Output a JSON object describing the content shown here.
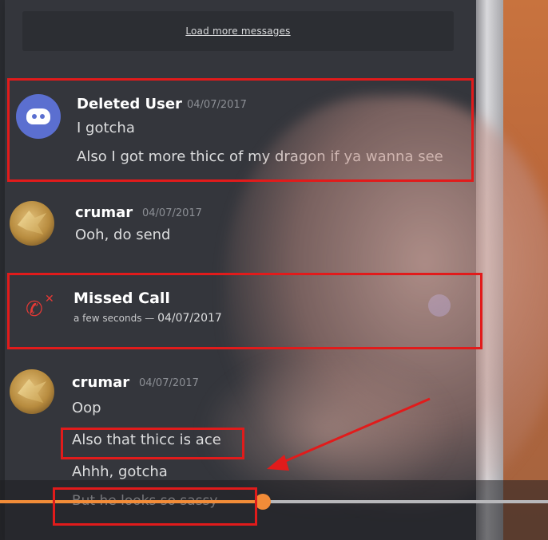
{
  "load_more": "Load more messages",
  "messages": [
    {
      "author": "Deleted User",
      "timestamp": "04/07/2017",
      "lines": [
        "I gotcha",
        "Also I got more thicc of my dragon if ya wanna see"
      ]
    },
    {
      "author": "crumar",
      "timestamp": "04/07/2017",
      "lines": [
        "Ooh, do send"
      ]
    }
  ],
  "missed_call": {
    "title": "Missed Call",
    "relative_time": "a few seconds",
    "separator": "—",
    "date": "04/07/2017"
  },
  "last_message": {
    "author": "crumar",
    "timestamp": "04/07/2017",
    "lines": [
      "Oop",
      "Also that thicc is ace",
      "Ahhh, gotcha",
      "But he looks so sassy"
    ]
  },
  "video": {
    "progress": 0.48,
    "colors": {
      "played": "#f28c38",
      "track": "#b8b8bb"
    }
  },
  "annotations": {
    "box_color": "#e11b1b",
    "arrow_color": "#e11b1b"
  },
  "icons": [
    "discord-logo-icon",
    "missed-call-icon",
    "call-avatar-icon",
    "progress-knob-icon"
  ]
}
